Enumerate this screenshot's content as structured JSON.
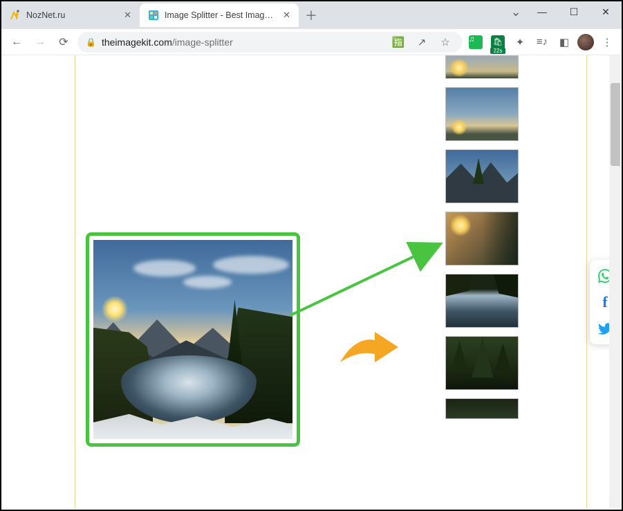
{
  "window": {
    "minimize_glyph": "—",
    "maximize_glyph": "☐",
    "close_glyph": "✕",
    "chevron_glyph": "⌄"
  },
  "tabs": [
    {
      "title": "NozNet.ru",
      "active": false
    },
    {
      "title": "Image Splitter - Best Image Split",
      "active": true
    }
  ],
  "newtab_glyph": "＋",
  "nav": {
    "back_glyph": "←",
    "forward_glyph": "→",
    "reload_glyph": "⟳"
  },
  "omnibox": {
    "lock_glyph": "🔒",
    "domain": "theimagekit.com",
    "path": "/image-splitter",
    "translate_glyph": "🈯",
    "share_glyph": "↗",
    "star_glyph": "☆"
  },
  "extensions": {
    "music_glyph": "♫",
    "cart_glyph": "🛍",
    "cart_badge": "22s",
    "puzzle_glyph": "✦",
    "playlist_glyph": "≡♪",
    "panel_glyph": "◧",
    "menu_glyph": "⋮"
  },
  "thumbnails": [
    {
      "name": "tile-1-partial-top"
    },
    {
      "name": "tile-2-sky-sunset"
    },
    {
      "name": "tile-3-mountain-pine"
    },
    {
      "name": "tile-4-valley-sun"
    },
    {
      "name": "tile-5-lake-reflection"
    },
    {
      "name": "tile-6-forest"
    },
    {
      "name": "tile-7-partial-bottom"
    }
  ],
  "social": {
    "whatsapp_glyph": "✆",
    "facebook_glyph": "f",
    "twitter_glyph": "🐦"
  }
}
